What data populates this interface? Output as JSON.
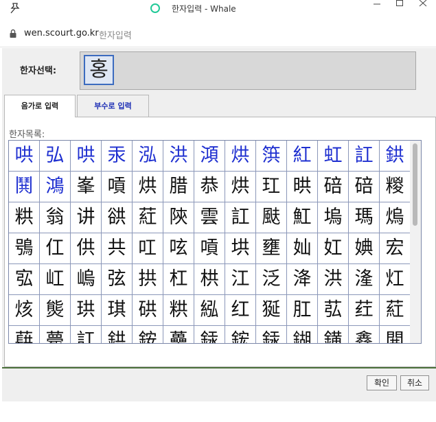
{
  "window": {
    "title": "한자입력 - Whale"
  },
  "address": {
    "url": "wen.scourt.go.kr",
    "page_title": "한자입력"
  },
  "selection": {
    "label": "한자선택:",
    "char": "홍"
  },
  "tabs": [
    {
      "label": "음가로 입력"
    },
    {
      "label": "부수로 입력"
    }
  ],
  "list_label": "한자목록:",
  "hanja": [
    [
      "哄",
      "弘",
      "哄",
      "汞",
      "泓",
      "洪",
      "澒",
      "烘",
      "篊",
      "紅",
      "虹",
      "訌",
      "鉷"
    ],
    [
      "鬨",
      "鴻",
      "峯",
      "嗊",
      "烘",
      "腊",
      "恭",
      "烘",
      "玒",
      "晎",
      "碚",
      "碚",
      "糉"
    ],
    [
      "粠",
      "翁",
      "讲",
      "谼",
      "葒",
      "陝",
      "雲",
      "訌",
      "颫",
      "魟",
      "塢",
      "瑪",
      "熓"
    ],
    [
      "鴞",
      "仜",
      "供",
      "共",
      "叿",
      "呟",
      "嗊",
      "垬",
      "壅",
      "奾",
      "妅",
      "婰",
      "宏"
    ],
    [
      "宖",
      "屸",
      "嵨",
      "弦",
      "拱",
      "杠",
      "栱",
      "江",
      "泛",
      "洚",
      "洪",
      "湰",
      "灴"
    ],
    [
      "烗",
      "熋",
      "珙",
      "琪",
      "硔",
      "粠",
      "紭",
      "红",
      "狿",
      "肛",
      "苰",
      "荭",
      "葒"
    ],
    [
      "蕻",
      "薨",
      "訌",
      "鉷",
      "銨",
      "蘽",
      "銾",
      "鋐",
      "銾",
      "鍸",
      "鐄",
      "鑫",
      "閧"
    ]
  ],
  "blue_cells": 15,
  "buttons": {
    "ok": "확인",
    "cancel": "취소"
  },
  "colors": {
    "accent": "#1e2fd0",
    "selected_border": "#3b6bbf"
  }
}
